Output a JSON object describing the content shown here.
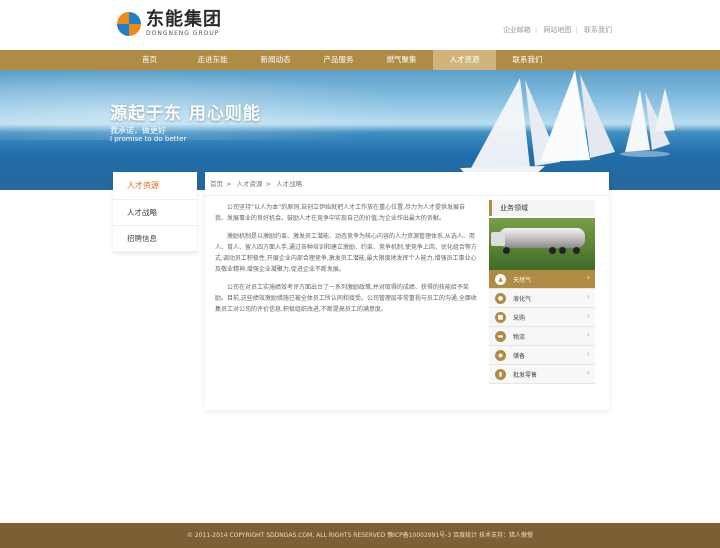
{
  "brand": {
    "name_cn": "东能集团",
    "name_en": "DONGNENG GROUP"
  },
  "top_links": [
    "企业邮箱",
    "网站地图",
    "联系我们"
  ],
  "nav": [
    {
      "label": "首页",
      "active": false
    },
    {
      "label": "走进东能",
      "active": false
    },
    {
      "label": "新闻动态",
      "active": false
    },
    {
      "label": "产品服务",
      "active": false
    },
    {
      "label": "燃气聚集",
      "active": false
    },
    {
      "label": "人才资源",
      "active": true
    },
    {
      "label": "联系我们",
      "active": false
    }
  ],
  "banner": {
    "title": "源起于东 用心则能",
    "sub_cn": "我承诺，做更好",
    "sub_en": "I promise to do better"
  },
  "sidebar": {
    "title": "人才资源",
    "items": [
      "人才战略",
      "招聘信息"
    ]
  },
  "breadcrumb": [
    "首页",
    "人才资源",
    "人才战略"
  ],
  "article": [
    "公司坚持“以人为本”的原则,自创立伊始就把人才工作放在重心位置,尽力为人才提供发展自我、发展事业的良好机会。鼓励人才在竞争中实现自己的价值,为企业作出最大的贡献。",
    "激励机制是以激励约束、激发员工潜能、动态竞争为核心内容的人力资源管理体系,从选人、用人、育人、留人四方面入手,通过各种培训和建立激励、约束、竞争机制,使竞争上岗、优化组合等方式,调动员工积极性,开展企业内部合理竞争,激发员工潜能,最大限度地发挥个人能力,增强员工事业心及敬业精神,增强企业凝聚力,促进企业不断发展。",
    "公司在对员工实施绩效考评方面出台了一系列激励政策,并对取得的成绩、获得的技能给予奖励。目前,这些绩效激励措施已被全体员工所认同和接受。公司管理层非常重视与员工的沟通,全面收集员工对公司的评价信息,积极组织改进,不断提高员工的满意度。"
  ],
  "business_panel": {
    "title": "业务领域",
    "items": [
      {
        "label": "天然气",
        "active": true,
        "icon": "flame-icon"
      },
      {
        "label": "液化气",
        "active": false,
        "icon": "gas-icon"
      },
      {
        "label": "采购",
        "active": false,
        "icon": "cart-icon"
      },
      {
        "label": "物流",
        "active": false,
        "icon": "truck-icon"
      },
      {
        "label": "储备",
        "active": false,
        "icon": "tank-icon"
      },
      {
        "label": "批发零售",
        "active": false,
        "icon": "cylinder-icon"
      }
    ]
  },
  "footer": "© 2011-2014 COPYRIGHT SDDNGAS.COM, ALL RIGHTS RESERVED  豫ICP备10002991号-3 百度统计  技术支持：猎人傲慢",
  "colors": {
    "brand_gold": "#b08b44",
    "footer_brown": "#7d5f35",
    "accent_orange": "#e06a1a"
  }
}
